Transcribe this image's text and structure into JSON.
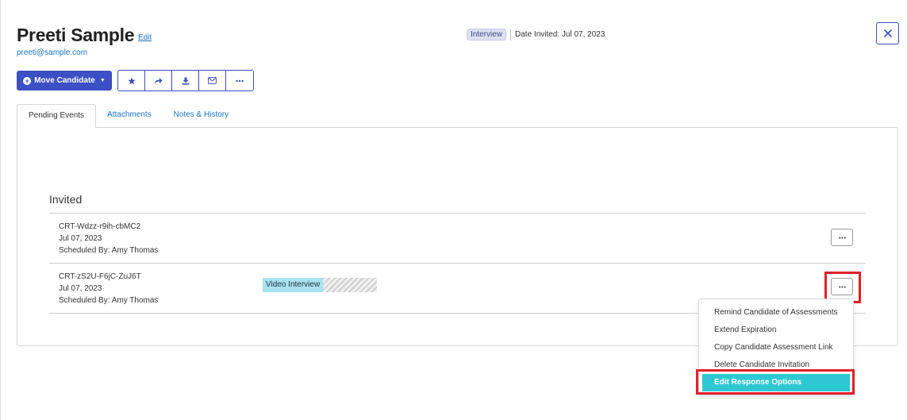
{
  "candidate": {
    "name": "Preeti Sample",
    "edit_label": "Edit",
    "email": "preeti@sample.com"
  },
  "header": {
    "badge": "Interview",
    "date_invited": "Date Invited: Jul 07, 2023"
  },
  "toolbar": {
    "move_label": "Move Candidate",
    "icons": [
      "star-icon",
      "share-icon",
      "download-icon",
      "envelope-icon",
      "more-icon"
    ]
  },
  "tabs": [
    {
      "label": "Pending Events",
      "active": true
    },
    {
      "label": "Attachments",
      "active": false
    },
    {
      "label": "Notes & History",
      "active": false
    }
  ],
  "section": {
    "title": "Invited"
  },
  "events": [
    {
      "id": "CRT-Wdzz-r9ih-cbMC2",
      "date": "Jul 07, 2023",
      "scheduled_by": "Scheduled By: Amy Thomas"
    },
    {
      "id": "CRT-zS2U-F6jC-ZuJ6T",
      "date": "Jul 07, 2023",
      "scheduled_by": "Scheduled By: Amy Thomas",
      "badge": "Video Interview"
    }
  ],
  "menu": {
    "items": [
      "Remind Candidate of Assessments",
      "Extend Expiration",
      "Copy Candidate Assessment Link",
      "Delete Candidate Invitation",
      "Edit Response Options"
    ],
    "selected_index": 4
  },
  "colors": {
    "primary": "#3d4fc4",
    "link": "#1a73c7",
    "highlight": "#e0202a",
    "selected_item": "#2ec8d2",
    "video_badge": "#a9e2ef"
  }
}
